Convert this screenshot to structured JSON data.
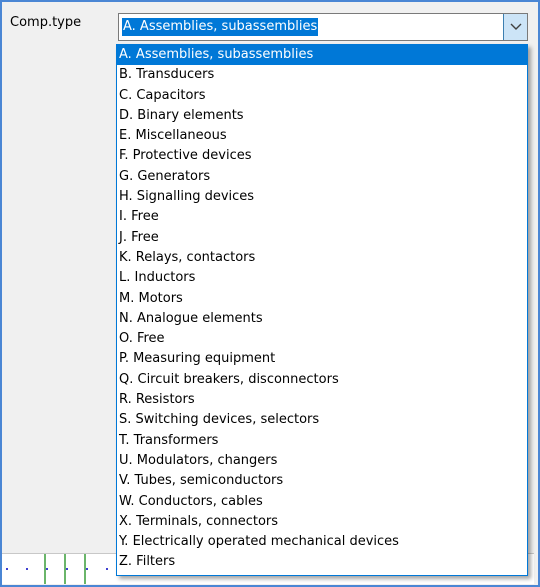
{
  "field": {
    "label": "Comp.type",
    "selected_value": "A. Assemblies, subassemblies"
  },
  "dropdown": {
    "selected_index": 0,
    "items": [
      "A. Assemblies, subassemblies",
      "B. Transducers",
      "C. Capacitors",
      "D. Binary elements",
      "E. Miscellaneous",
      "F. Protective devices",
      "G. Generators",
      "H. Signalling devices",
      "I. Free",
      "J. Free",
      "K. Relays, contactors",
      "L. Inductors",
      "M. Motors",
      "N. Analogue elements",
      "O. Free",
      "P. Measuring equipment",
      "Q. Circuit breakers, disconnectors",
      "R. Resistors",
      "S. Switching devices, selectors",
      "T. Transformers",
      "U. Modulators, changers",
      "V. Tubes, semiconductors",
      "W. Conductors, cables",
      "X. Terminals, connectors",
      "Y. Electrically operated mechanical devices",
      "Z. Filters"
    ]
  },
  "icons": {
    "dropdown_button": "chevron-down-icon"
  },
  "colors": {
    "selection": "#0078d7",
    "window_border": "#4a86d4",
    "button_hover": "#cce4f7"
  }
}
